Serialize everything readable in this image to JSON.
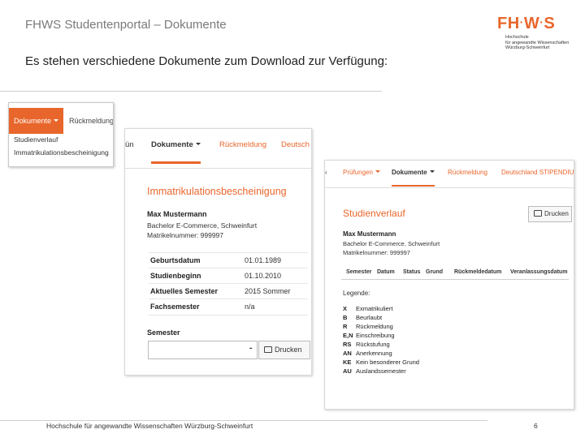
{
  "slide": {
    "title": "FHWS Studentenportal – Dokumente",
    "subtitle": "Es stehen verschiedene Dokumente zum Download zur Verfügung:",
    "footer": "Hochschule für angewandte Wissenschaften Würzburg-Schweinfurt",
    "page_number": "6"
  },
  "logo": {
    "mark_left": "FH",
    "mark_mid": "W",
    "mark_right": "S",
    "line1": "Hochschule",
    "line2": "für angewandte Wissenschaften",
    "line3": "Würzburg-Schweinfurt"
  },
  "dropdown_shot": {
    "active_tab": "Dokumente",
    "tab2": "Rückmeldung",
    "items": [
      "Studienverlauf",
      "Immatrikulationsbescheinigung"
    ]
  },
  "immatrikulation_shot": {
    "nav": [
      "ün",
      "Dokumente",
      "Rückmeldung",
      "Deutsch"
    ],
    "heading": "Immatrikulationsbescheinigung",
    "name": "Max Mustermann",
    "program": "Bachelor E-Commerce, Schweinfurt",
    "matrikel": "Matrikelnummer: 999997",
    "rows": [
      {
        "label": "Geburtsdatum",
        "value": "01.01.1989"
      },
      {
        "label": "Studienbeginn",
        "value": "01.10.2010"
      },
      {
        "label": "Aktuelles Semester",
        "value": "2015 Sommer"
      },
      {
        "label": "Fachsemester",
        "value": "n/a"
      }
    ],
    "semester_label": "Semester",
    "print_label": "Drucken"
  },
  "studienverlauf_shot": {
    "nav": [
      "Prüfungen",
      "Dokumente",
      "Rückmeldung",
      "Deutschland STIPENDIU"
    ],
    "heading": "Studienverlauf",
    "print_label": "Drucken",
    "name": "Max Mustermann",
    "program": "Bachelor E-Commerce, Schweinfurt",
    "matrikel": "Matrikelnummer: 999997",
    "columns": [
      "Semester",
      "Datum",
      "Status",
      "Grund",
      "Rückmeldedatum",
      "Veranlassungsdatum"
    ],
    "legend_title": "Legende:",
    "legend": [
      {
        "code": "X",
        "text": "Exmatrikuliert"
      },
      {
        "code": "B",
        "text": "Beurlaubt"
      },
      {
        "code": "R",
        "text": "Rückmeldung"
      },
      {
        "code": "E,N",
        "text": "Einschreibung"
      },
      {
        "code": "RS",
        "text": "Rückstufung"
      },
      {
        "code": "AN",
        "text": "Anerkennung"
      },
      {
        "code": "KE",
        "text": "Kein besonderer Grund"
      },
      {
        "code": "AU",
        "text": "Auslandssemester"
      }
    ]
  },
  "colors": {
    "accent": "#e8662b",
    "text": "#222222",
    "title_gray": "#7a7a7a"
  }
}
